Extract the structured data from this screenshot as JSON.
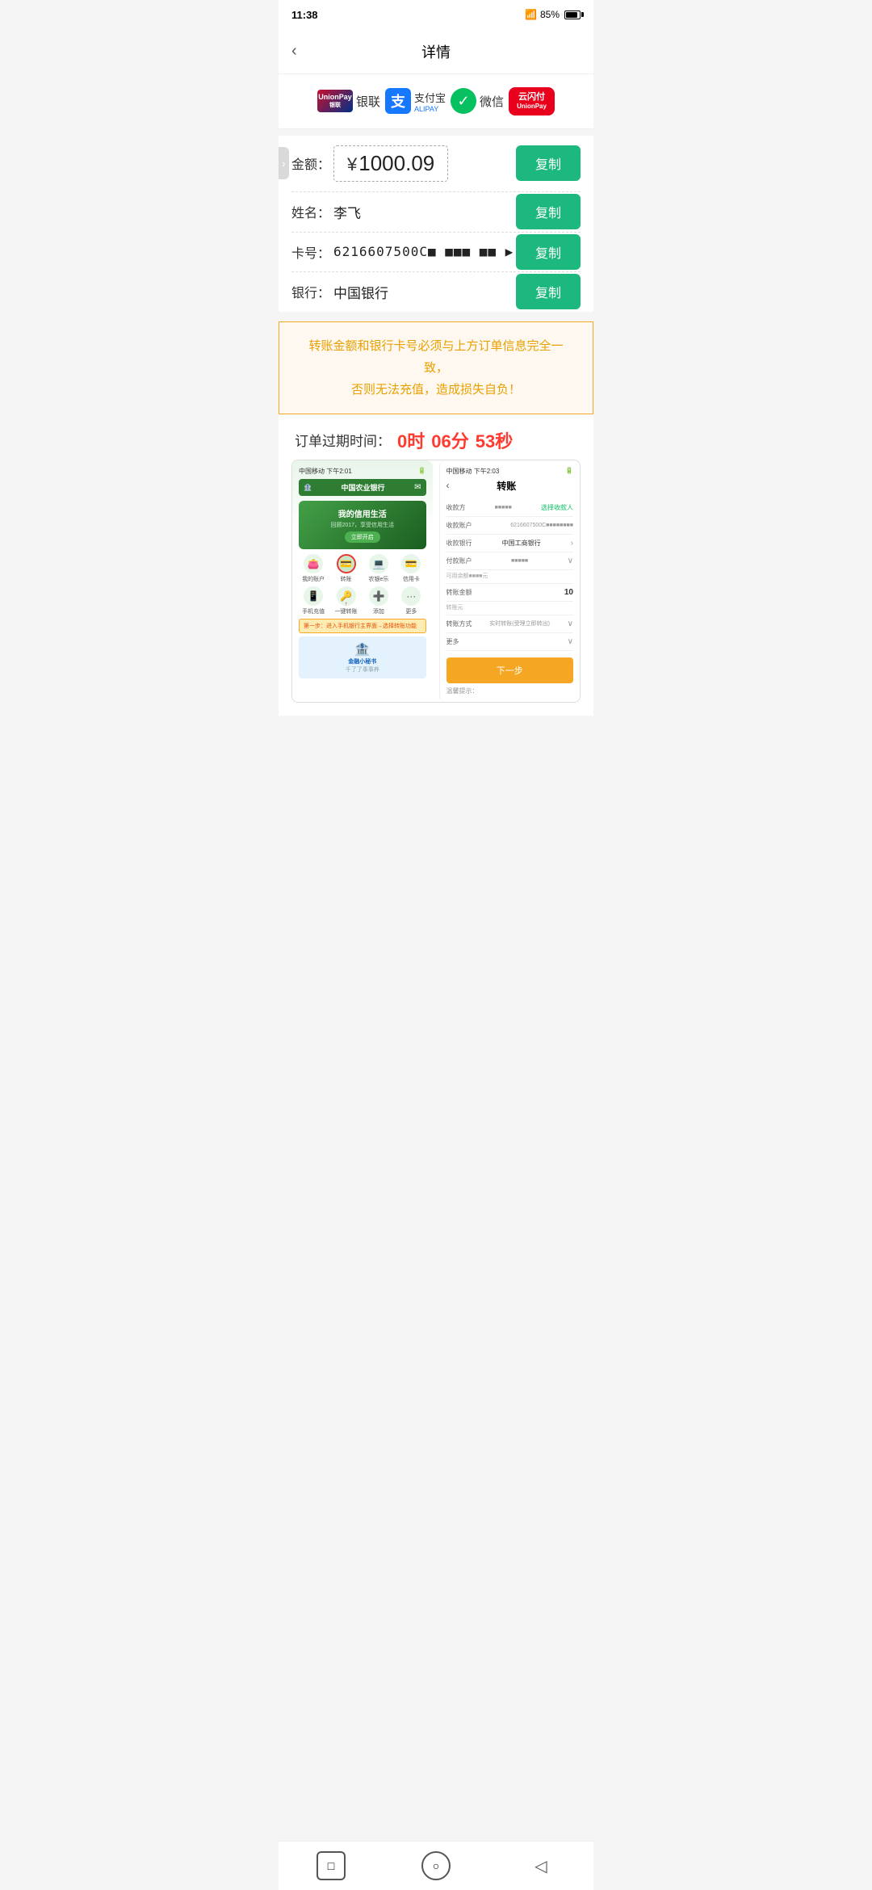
{
  "statusBar": {
    "time": "11:38",
    "battery": "85%",
    "signal": "4G"
  },
  "header": {
    "title": "详情",
    "backLabel": "‹"
  },
  "paymentLogos": [
    {
      "name": "银联",
      "type": "unionpay"
    },
    {
      "name": "支付宝",
      "subname": "ALIPAY",
      "type": "alipay"
    },
    {
      "name": "微信",
      "type": "wechat"
    },
    {
      "name": "云闪付",
      "subname": "UnionPay",
      "type": "yunpay"
    }
  ],
  "fields": {
    "amount": {
      "label": "金额：",
      "symbol": "¥",
      "value": "1000.09",
      "copyBtn": "复制"
    },
    "name": {
      "label": "姓名：",
      "value": "李飞",
      "copyBtn": "复制"
    },
    "card": {
      "label": "卡号：",
      "value": "6216607500C■ ■■■ ■■ ▶",
      "copyBtn": "复制"
    },
    "bank": {
      "label": "银行：",
      "value": "中国银行",
      "copyBtn": "复制"
    }
  },
  "warning": {
    "line1": "转账金额和银行卡号必须与上方订单信息完全一",
    "line2": "致，",
    "line3": "否则无法充值，造成损失自负！"
  },
  "timer": {
    "label": "订单过期时间：",
    "hours": "0时",
    "minutes": "06分",
    "seconds": "53秒"
  },
  "tutorial": {
    "leftPhone": {
      "status": "中国移动 下午2:01",
      "bankName": "中国农业银行",
      "slogan": "我的信用生活",
      "slogan2": "回顾2017，享受信用生活",
      "btn": "立即开启",
      "icons": [
        {
          "icon": "👛",
          "label": "我的账户"
        },
        {
          "icon": "💳",
          "label": "转账"
        },
        {
          "icon": "💻",
          "label": "农银e乐"
        },
        {
          "icon": "💳",
          "label": "信用卡"
        }
      ],
      "icons2": [
        {
          "icon": "📱",
          "label": "手机充值"
        },
        {
          "icon": "🔑",
          "label": "一键转账"
        },
        {
          "icon": "➕",
          "label": "添加"
        },
        {
          "icon": "···",
          "label": "更多"
        }
      ],
      "stepText": "第一步：进入手机银行主界面→选择转账功能",
      "bookTitle": "金融小秘书",
      "bookSubtitle": "千了了事事养"
    },
    "rightPhone": {
      "status": "中国移动 下午2:03",
      "title": "转账",
      "rows": [
        {
          "label": "收款方",
          "value": "■■■■■"
        },
        {
          "label": "收款账户",
          "value": "6216607500C■■■■■■■■"
        },
        {
          "label": "收款银行",
          "value": "中国工商银行",
          "hasArrow": true
        },
        {
          "label": "付款账户",
          "value": "■■■■■",
          "hasDropdown": true
        },
        {
          "label": "可用余额■■■■元",
          "value": ""
        },
        {
          "label": "转账金额",
          "value": "10"
        },
        {
          "label": "转账元",
          "value": ""
        },
        {
          "label": "转账方式",
          "value": "实时转账(受理立即转出)",
          "hasDropdown": true
        },
        {
          "label": "更多",
          "value": "",
          "hasDropdown": true
        }
      ],
      "nextBtn": "下一步",
      "hint": "温馨提示："
    }
  },
  "nav": {
    "squareBtn": "□",
    "circleBtn": "○",
    "backBtn": "◁"
  }
}
